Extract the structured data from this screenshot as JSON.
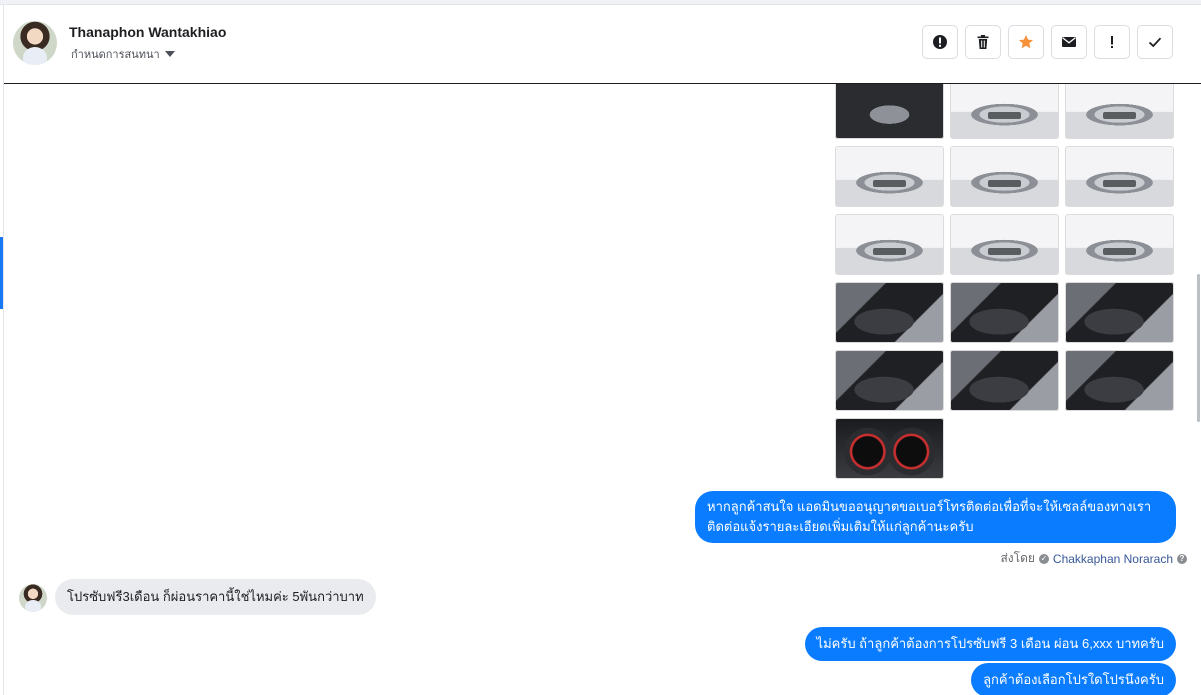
{
  "header": {
    "contact_name": "Thanaphon Wantakhiao",
    "assign_label": "กำหนดการสนทนา"
  },
  "actions": [
    {
      "name": "report-spam-button",
      "icon": "alert-circle-icon"
    },
    {
      "name": "delete-button",
      "icon": "trash-icon"
    },
    {
      "name": "star-button",
      "icon": "star-icon",
      "color": "#f7923b"
    },
    {
      "name": "mark-unread-button",
      "icon": "envelope-icon"
    },
    {
      "name": "follow-up-button",
      "icon": "exclamation-icon"
    },
    {
      "name": "mark-done-button",
      "icon": "check-icon"
    }
  ],
  "thread": {
    "photo_grid": [
      [
        "eng",
        "ext",
        "ext"
      ],
      [
        "ext",
        "ext",
        "ext"
      ],
      [
        "ext",
        "ext",
        "ext"
      ],
      [
        "int",
        "int",
        "int"
      ],
      [
        "int",
        "int",
        "int"
      ],
      [
        "gauge"
      ]
    ],
    "messages": [
      {
        "direction": "outgoing",
        "text_line1": "หากลูกค้าสนใจ แอดมินขออนุญาตขอเบอร์โทรติดต่อเพื่อที่จะให้เซลล์ของทางเรา",
        "text_line2": "ติดต่อแจ้งรายละเอียดเพิ่มเติมให้แก่ลูกค้านะครับ"
      },
      {
        "direction": "incoming",
        "text": "โปรซับฟรี3เดือน ก็ผ่อนราคานี้ใช่ไหมค่ะ 5พันกว่าบาท"
      },
      {
        "direction": "outgoing",
        "text": "ไม่ครับ ถ้าลูกค้าต้องการโปรซับฟรี 3 เดือน ผ่อน 6,xxx บาทครับ"
      },
      {
        "direction": "outgoing",
        "text": "ลูกค้าต้องเลือกโปรใดโปรนึงครับ"
      }
    ],
    "sent_by_label": "ส่งโดย",
    "sent_by_agent": "Chakkaphan Norarach"
  },
  "colors": {
    "outgoing_bubble": "#0a7cff",
    "incoming_bubble": "#eaebee",
    "accent": "#1877f2"
  }
}
